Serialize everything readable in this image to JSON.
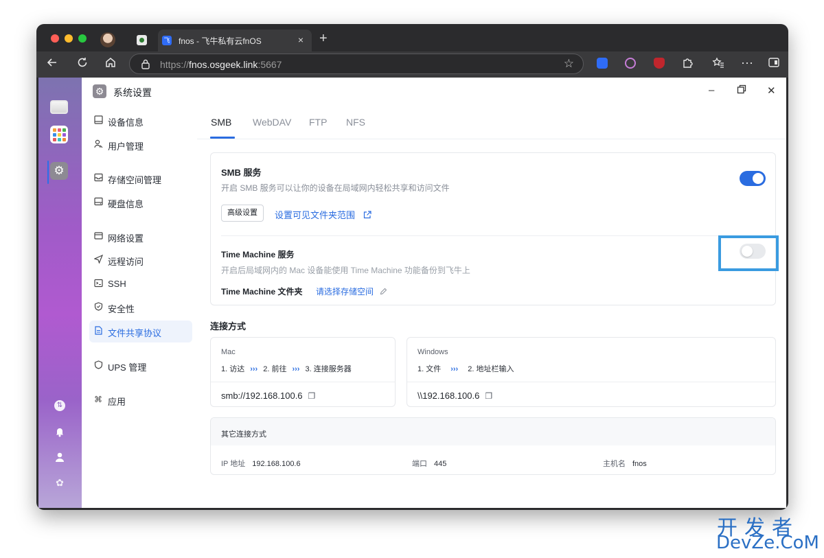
{
  "browser": {
    "tab_title": "fnos - 飞牛私有云fnOS",
    "tab_favicon": "飞",
    "url_prefix": "https://",
    "url_host": "fnos.osgeek.link",
    "url_suffix": ":5667",
    "close_glyph": "×",
    "new_tab_glyph": "+"
  },
  "app": {
    "title": "系统设置"
  },
  "sidebar": {
    "items": [
      {
        "label": "设备信息",
        "icon": "monitor-icon"
      },
      {
        "label": "用户管理",
        "icon": "user-icon"
      },
      {
        "label": "存储空间管理",
        "icon": "storage-icon"
      },
      {
        "label": "硬盘信息",
        "icon": "disk-icon"
      },
      {
        "label": "网络设置",
        "icon": "network-icon"
      },
      {
        "label": "远程访问",
        "icon": "send-icon"
      },
      {
        "label": "SSH",
        "icon": "terminal-icon"
      },
      {
        "label": "安全性",
        "icon": "shield-icon"
      },
      {
        "label": "文件共享协议",
        "icon": "document-icon",
        "active": true
      },
      {
        "label": "UPS 管理",
        "icon": "shield-outline-icon"
      },
      {
        "label": "应用",
        "icon": "command-icon"
      }
    ]
  },
  "tabs": [
    "SMB",
    "WebDAV",
    "FTP",
    "NFS"
  ],
  "smb": {
    "title": "SMB 服务",
    "desc": "开启 SMB 服务可以让你的设备在局域网内轻松共享和访问文件",
    "enabled": true,
    "advanced_button": "高级设置",
    "visible_folder_link": "设置可见文件夹范围"
  },
  "time_machine": {
    "title": "Time Machine 服务",
    "desc": "开启后局域网内的 Mac 设备能使用 Time Machine 功能备份到飞牛上",
    "enabled": false,
    "folder_label": "Time Machine 文件夹",
    "folder_link": "请选择存储空间"
  },
  "connection": {
    "heading": "连接方式",
    "mac": {
      "title": "Mac",
      "step1": "1. 访达",
      "step2": "2. 前往",
      "step3": "3. 连接服务器",
      "address": "smb://192.168.100.6"
    },
    "windows": {
      "title": "Windows",
      "step1": "1. 文件",
      "step2": "2. 地址栏输入",
      "address": "\\\\192.168.100.6"
    },
    "arrow_glyph": "›››"
  },
  "other": {
    "title": "其它连接方式",
    "ip_label": "IP 地址",
    "ip_value": "192.168.100.6",
    "port_label": "端口",
    "port_value": "445",
    "host_label": "主机名",
    "host_value": "fnos"
  },
  "watermark": {
    "line1": "开发者",
    "line2": "DevZe.CoM"
  },
  "colors": {
    "accent": "#2a6ce0",
    "highlight_border": "#3a9be0"
  }
}
